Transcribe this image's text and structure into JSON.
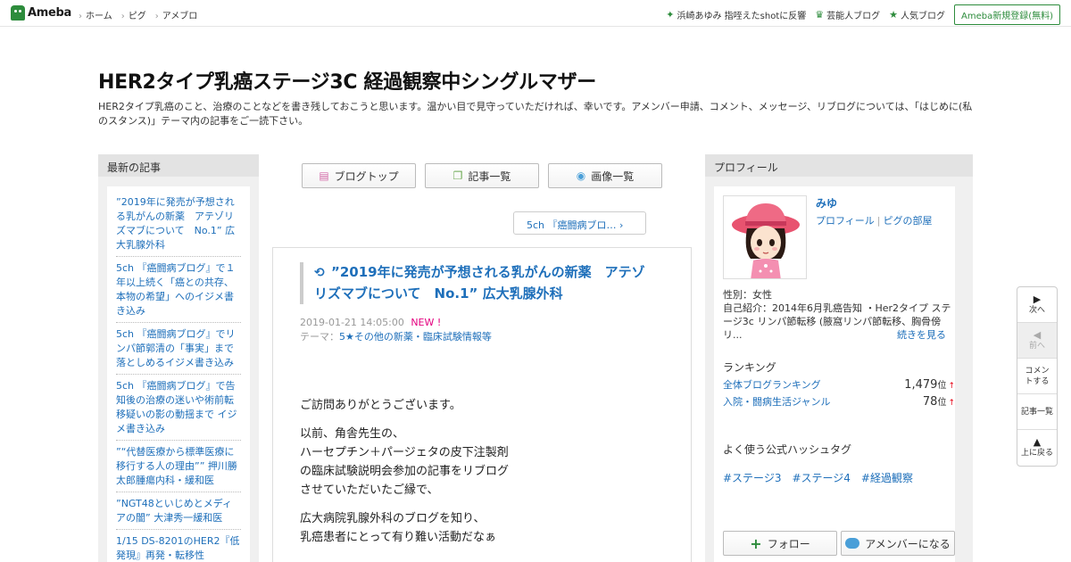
{
  "topbar": {
    "logo": "Ameba",
    "nav": [
      "ホーム",
      "ピグ",
      "アメブロ"
    ],
    "trending": "浜崎あゆみ 指咥えたshotに反響",
    "celeb_blog": "芸能人ブログ",
    "popular_blog": "人気ブログ",
    "signup": "Ameba新規登録(無料)"
  },
  "header": {
    "title": "HER2タイプ乳癌ステージ3C 経過観察中シングルマザー",
    "description": "HER2タイプ乳癌のこと、治療のことなどを書き残しておこうと思います。温かい目で見守っていただければ、幸いです。アメンバー申請、コメント、メッセージ、リブログについては、「はじめに(私のスタンス)」テーマ内の記事をご一読下さい。"
  },
  "sidebar_left": {
    "heading": "最新の記事",
    "items": [
      "”2019年に発売が予想される乳がんの新薬　アテゾリズマブについて　No.1” 広大乳腺外科",
      "5ch 『癌闘病ブログ』で１年以上続く「癌との共存、本物の希望」へのイジメ書き込み",
      "5ch 『癌闘病ブログ』でリンパ節郭清の「事実」まで落としめるイジメ書き込み",
      "5ch 『癌闘病ブログ』で告知後の治療の迷いや術前転移疑いの影の動揺まで イジメ書き込み",
      "”“代替医療から標準医療に移行する人の理由”” 押川勝太郎腫瘍内科・緩和医",
      "”NGT48といじめとメディアの闇” 大津秀一緩和医",
      "1/15 DS-8201のHER2『低発現』再発・転移性"
    ]
  },
  "center": {
    "buttons": {
      "blog_top": "ブログトップ",
      "articles": "記事一覧",
      "images": "画像一覧"
    },
    "next_link": "5ch 『癌闘病ブロ…",
    "entry": {
      "title": "”2019年に発売が予想される乳がんの新薬　アテゾリズマブについて　No.1” 広大乳腺外科",
      "date": "2019-01-21 14:05:00",
      "new_label": "NEW !",
      "theme_label": "テーマ：",
      "theme": "5★その他の新薬・臨床試験情報等",
      "body": [
        "ご訪問ありがとうございます。",
        "以前、角舎先生の、\nハーセプチン＋パージェタの皮下注製剤\nの臨床試験説明会参加の記事をリブログ\nさせていただいたご縁で、",
        "広大病院乳腺外科のブログを知り、\n乳癌患者にとって有り難い活動だなぁ"
      ]
    }
  },
  "sidebar_right": {
    "heading": "プロフィール",
    "name": "みゆ",
    "link_profile": "プロフィール",
    "link_pig": "ピグの部屋",
    "gender": "性別：女性",
    "intro": "自己紹介：2014年6月乳癌告知 ・Her2タイプ ステージ3c リンパ節転移 (腋窩リンパ節転移、胸骨傍リ...",
    "more": "続きを見る",
    "ranking_heading": "ランキング",
    "rankings": [
      {
        "label": "全体ブログランキング",
        "value": "1,479",
        "unit": "位",
        "arrow": "↑"
      },
      {
        "label": "入院・闘病生活ジャンル",
        "value": "78",
        "unit": "位",
        "arrow": "↑"
      }
    ],
    "hashtag_heading": "よく使う公式ハッシュタグ",
    "hashtags": [
      "#ステージ3",
      "#ステージ4",
      "#経過観察"
    ],
    "follow": "フォロー",
    "amember": "アメンバーになる"
  },
  "sidenav": {
    "next": "次へ",
    "prev": "前へ",
    "comment": "コメントする",
    "list": "記事一覧",
    "top": "上に戻る"
  },
  "colors": {
    "brand_green": "#2d8c3c",
    "link_blue": "#1e6fba",
    "new_pink": "#e4007f"
  }
}
